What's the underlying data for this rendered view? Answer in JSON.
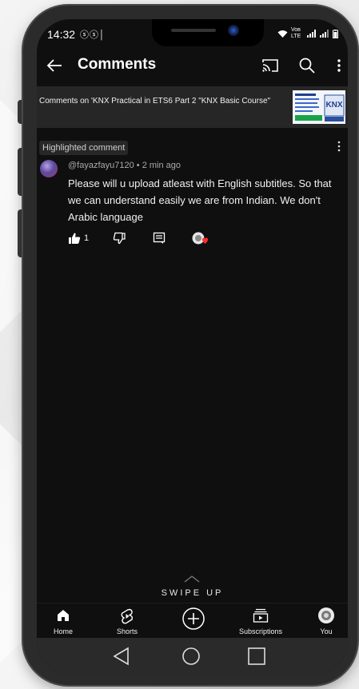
{
  "status": {
    "time": "14:32",
    "left_icons": "ⓢⓢ│",
    "carrier": "Voʙ LTE"
  },
  "appbar": {
    "title": "Comments",
    "back_icon": "arrow-left-icon",
    "cast_icon": "cast-icon",
    "search_icon": "search-icon",
    "menu_icon": "more-vertical-icon"
  },
  "video": {
    "title": "Comments on 'KNX Practical in ETS6 Part 2 \"KNX Basic Course\"",
    "thumb_label": "KNX BASIC"
  },
  "highlighted": {
    "badge": "Highlighted comment",
    "author": "@fayazfayu7120",
    "age": "2 min ago",
    "separator": "•",
    "text": "Please will  u upload  atleast with English subtitles. So that we can understand  easily we are from Indian. We don't Arabic language",
    "like_count": "1"
  },
  "swipe_up": "SWIPE UP",
  "nav": {
    "items": [
      {
        "label": "Home",
        "icon": "home-icon"
      },
      {
        "label": "Shorts",
        "icon": "shorts-icon"
      },
      {
        "label": "",
        "icon": "create-plus-icon"
      },
      {
        "label": "Subscriptions",
        "icon": "subscriptions-icon"
      },
      {
        "label": "You",
        "icon": "you-avatar-icon"
      }
    ]
  },
  "system_nav": {
    "back": "triangle-back-icon",
    "home": "circle-home-icon",
    "recents": "square-recents-icon"
  },
  "colors": {
    "screen_bg": "#0f0f0f",
    "video_row_bg": "#262626",
    "badge_bg": "#272727",
    "text_primary": "#f1f1f1",
    "text_secondary": "#aaaaaa",
    "phone_frame": "#2b2b2b"
  }
}
